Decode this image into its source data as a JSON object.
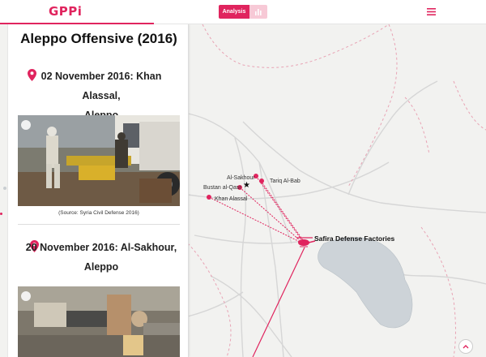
{
  "header": {
    "logo": "GPPi",
    "analysis_label": "Analysis"
  },
  "panel": {
    "title": "Aleppo Offensive (2016)",
    "entries": [
      {
        "heading_line1": "02 November 2016: Khan Alassal,",
        "heading_line2": "Aleppo",
        "caption": "(Source: Syria Civil Defense 2016)"
      },
      {
        "heading_line1": "20 November 2016: Al-Sakhour,",
        "heading_line2": "Aleppo"
      }
    ]
  },
  "map": {
    "labels": {
      "al_sakhour": "Al-Sakhour",
      "tariq_al_bab": "Tariq Al-Bab",
      "bustan_al_qasr": "Bustan al-Qasr",
      "khan_alassal": "Khan Alassal",
      "safira": "Safira Defense Factories"
    }
  },
  "colors": {
    "accent": "#e0245e",
    "map_background": "#f2f2f0",
    "roads": "#d9d9d9",
    "lake": "#cfd4d8"
  }
}
